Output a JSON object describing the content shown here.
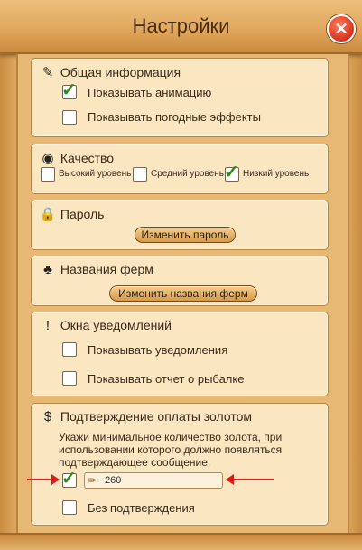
{
  "window": {
    "title": "Настройки"
  },
  "general": {
    "header": "Общая информация",
    "show_animation": "Показывать анимацию",
    "show_weather": "Показывать погодные эффекты"
  },
  "quality": {
    "header": "Качество",
    "high": "Высокий уровень",
    "medium": "Средний уровень",
    "low": "Низкий уровень"
  },
  "password": {
    "header": "Пароль",
    "change_button": "Изменить пароль"
  },
  "farms": {
    "header": "Названия ферм",
    "change_button": "Изменить названия ферм"
  },
  "notifications": {
    "header": "Окна уведомлений",
    "show_notifications": "Показывать уведомления",
    "show_fishing_report": "Показывать отчет о рыбалке"
  },
  "gold": {
    "header": "Подтверждение оплаты золотом",
    "description": "Укажи минимальное количество золота, при использовании которого должно появляться подтверждающее сообщение.",
    "amount": "260",
    "no_confirm": "Без подтверждения"
  }
}
